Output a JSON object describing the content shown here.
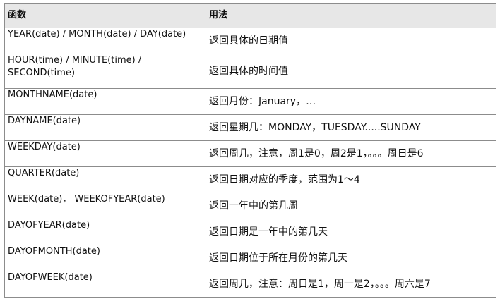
{
  "table": {
    "headers": [
      "函数",
      "用法"
    ],
    "rows": [
      {
        "function": "YEAR(date) / MONTH(date) / DAY(date)",
        "usage": "返回具体的日期值"
      },
      {
        "function": "HOUR(time) / MINUTE(time) / SECOND(time)",
        "usage": "返回具体的时间值"
      },
      {
        "function": "MONTHNAME(date)",
        "usage": "返回月份：January，…"
      },
      {
        "function": "DAYNAME(date)",
        "usage": "返回星期几：MONDAY，TUESDAY.....SUNDAY"
      },
      {
        "function": "WEEKDAY(date)",
        "usage": "返回周几，注意，周1是0，周2是1，。。。周日是6"
      },
      {
        "function": "QUARTER(date)",
        "usage": "返回日期对应的季度，范围为1～4"
      },
      {
        "function": "WEEK(date)， WEEKOFYEAR(date)",
        "usage": "返回一年中的第几周"
      },
      {
        "function": "DAYOFYEAR(date)",
        "usage": "返回日期是一年中的第几天"
      },
      {
        "function": "DAYOFMONTH(date)",
        "usage": "返回日期位于所在月份的第几天"
      },
      {
        "function": "DAYOFWEEK(date)",
        "usage": "返回周几，注意：周日是1，周一是2，。。。周六是7"
      }
    ]
  }
}
